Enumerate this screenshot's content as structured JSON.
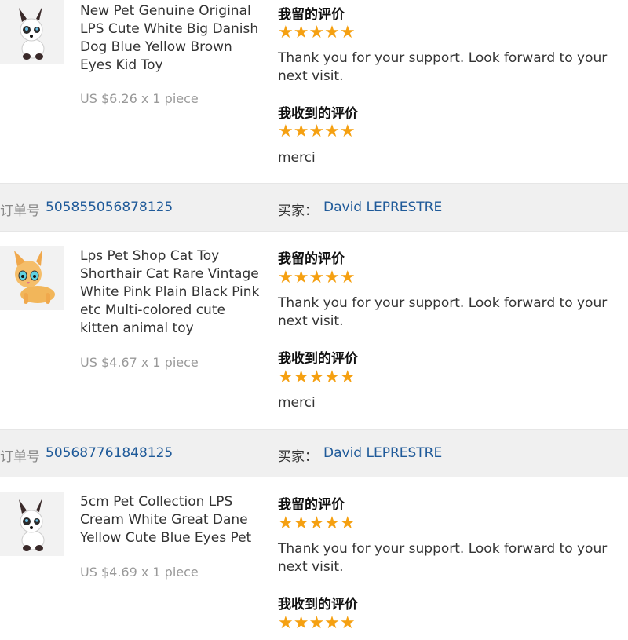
{
  "items": [
    {
      "title": "New Pet Genuine Original\nLPS Cute White Big Danish\nDog Blue Yellow Brown\nEyes Kid Toy",
      "price": "US $6.26 x 1 piece",
      "given_review_heading": "我留的评价",
      "given_review_stars": "★★★★★",
      "given_review_text": "Thank you for your support. Look forward to your next visit.",
      "received_review_heading": "我收到的评价",
      "received_review_stars": "★★★★★",
      "received_review_text": "merci",
      "thumbnail_icon": "dane-dog-toy-icon"
    },
    {
      "title": "Lps Pet Shop Cat Toy\nShorthair Cat Rare Vintage\nWhite Pink Plain Black Pink\netc Multi-colored cute\nkitten animal toy",
      "price": "US $4.67 x 1 piece",
      "given_review_heading": "我留的评价",
      "given_review_stars": "★★★★★",
      "given_review_text": "Thank you for your support. Look forward to your next visit.",
      "received_review_heading": "我收到的评价",
      "received_review_stars": "★★★★★",
      "received_review_text": "merci",
      "thumbnail_icon": "orange-cat-toy-icon"
    },
    {
      "title": "5cm Pet Collection LPS\nCream White Great Dane\nYellow Cute Blue Eyes Pet",
      "price": "US $4.69 x 1 piece",
      "given_review_heading": "我留的评价",
      "given_review_stars": "★★★★★",
      "given_review_text": "Thank you for your support. Look forward to your next visit.",
      "received_review_heading": "我收到的评价",
      "received_review_stars": "★★★★★",
      "received_review_text": "",
      "thumbnail_icon": "dane-dog-toy-icon"
    }
  ],
  "orders": [
    {
      "order_label": "订单号",
      "order_number": "505855056878125",
      "buyer_label": "买家：",
      "buyer_name": "David LEPRESTRE"
    },
    {
      "order_label": "订单号",
      "order_number": "505687761848125",
      "buyer_label": "买家：",
      "buyer_name": "David LEPRESTRE"
    }
  ],
  "colors": {
    "star": "#f5a011",
    "link": "#1f5a99",
    "header_bg": "#f0f0f0"
  }
}
